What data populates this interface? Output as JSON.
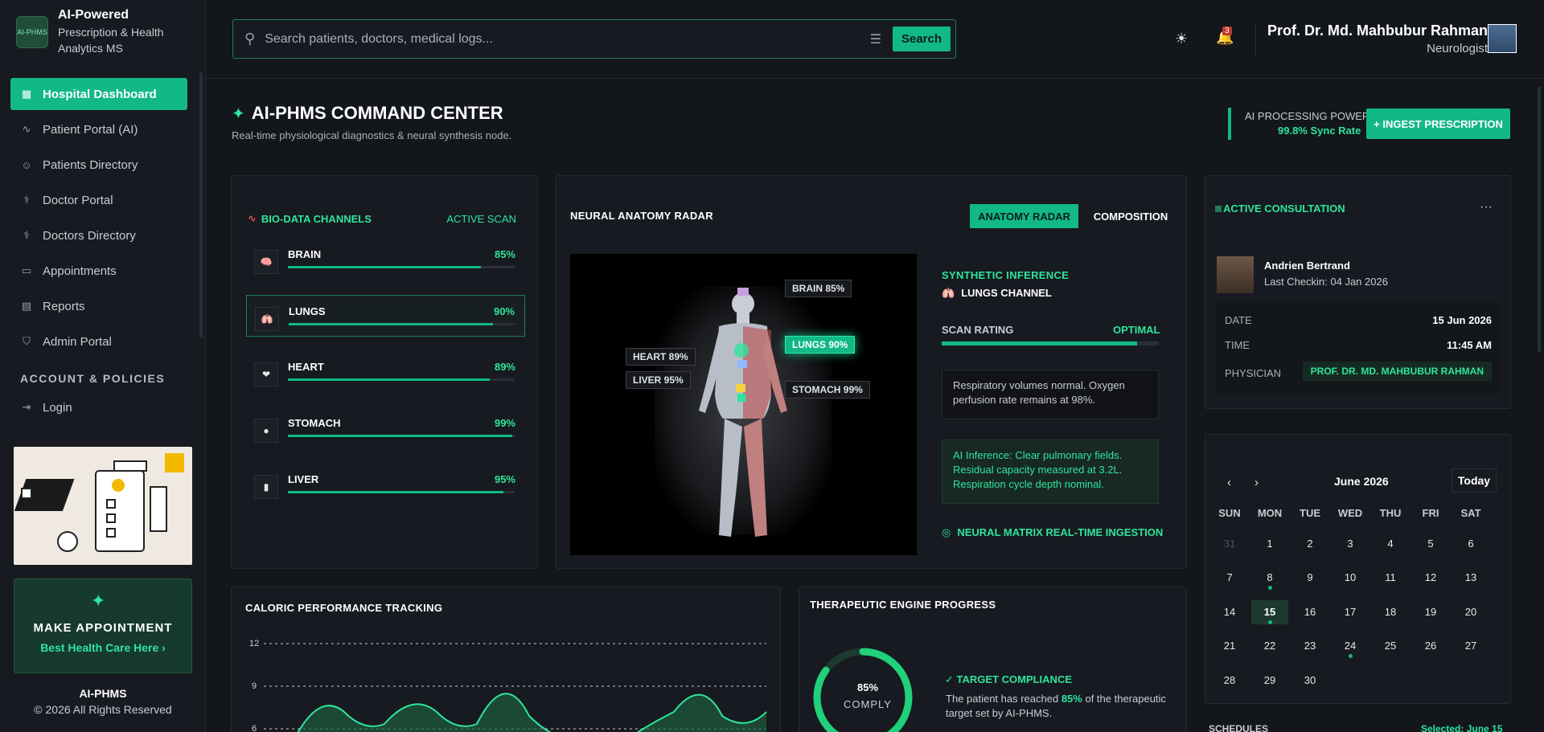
{
  "brand": {
    "logo_text": "AI-PHMS",
    "title": "AI-Powered",
    "subtitle_lines": [
      "Prescription & Health",
      "Analytics MS"
    ]
  },
  "nav": [
    {
      "label": "Hospital Dashboard",
      "icon": "grid-icon",
      "active": true
    },
    {
      "label": "Patient Portal (AI)",
      "icon": "activity-icon"
    },
    {
      "label": "Patients Directory",
      "icon": "users-icon"
    },
    {
      "label": "Doctor Portal",
      "icon": "stethoscope-icon"
    },
    {
      "label": "Doctors Directory",
      "icon": "stethoscope-icon"
    },
    {
      "label": "Appointments",
      "icon": "calendar-icon"
    },
    {
      "label": "Reports",
      "icon": "file-icon"
    },
    {
      "label": "Admin Portal",
      "icon": "shield-icon"
    }
  ],
  "account_section": "ACCOUNT & POLICIES",
  "login_label": "Login",
  "appointment_card": {
    "title": "MAKE APPOINTMENT",
    "link": "Best Health Care Here"
  },
  "footer": {
    "name": "AI-PHMS",
    "copyright": "© 2026 All Rights Reserved"
  },
  "search": {
    "placeholder": "Search patients, doctors, medical logs...",
    "button": "Search"
  },
  "notifications_count": "3",
  "user": {
    "name": "Prof. Dr. Md. Mahbubur Rahman",
    "role": "Neurologist"
  },
  "header": {
    "title": "AI-PHMS COMMAND CENTER",
    "subtitle": "Real-time physiological diagnostics & neural synthesis node.",
    "processing_label": "AI PROCESSING POWER",
    "processing_value": "99.8% Sync Rate",
    "ingest_button": "+ INGEST PRESCRIPTION"
  },
  "bio": {
    "title": "BIO-DATA CHANNELS",
    "status": "ACTIVE SCAN",
    "organs": [
      {
        "name": "BRAIN",
        "value": "85%",
        "pct": 85,
        "emoji": "🧠"
      },
      {
        "name": "LUNGS",
        "value": "90%",
        "pct": 90,
        "emoji": "🫁",
        "selected": true
      },
      {
        "name": "HEART",
        "value": "89%",
        "pct": 89,
        "emoji": "❤"
      },
      {
        "name": "STOMACH",
        "value": "99%",
        "pct": 99,
        "emoji": "●"
      },
      {
        "name": "LIVER",
        "value": "95%",
        "pct": 95,
        "emoji": "▮"
      }
    ]
  },
  "radar": {
    "title": "NEURAL ANATOMY RADAR",
    "tab_active": "ANATOMY RADAR",
    "tab_other": "COMPOSITION",
    "tags": {
      "brain": "BRAIN 85%",
      "lungs": "LUNGS 90%",
      "heart": "HEART 89%",
      "liver": "LIVER 95%",
      "stomach": "STOMACH 99%"
    },
    "inference_title": "SYNTHETIC INFERENCE",
    "inference_channel": "LUNGS CHANNEL",
    "scan_label": "SCAN RATING",
    "scan_value": "OPTIMAL",
    "scan_pct": 90,
    "note": "Respiratory volumes normal. Oxygen perfusion rate remains at 98%.",
    "ai_note": "AI Inference: Clear pulmonary fields. Residual capacity measured at 3.2L. Respiration cycle depth nominal.",
    "ingestion": "NEURAL MATRIX REAL-TIME INGESTION"
  },
  "consult": {
    "title": "ACTIVE CONSULTATION",
    "patient": "Andrien Bertrand",
    "checkin": "Last Checkin: 04 Jan 2026",
    "date_label": "DATE",
    "date": "15 Jun 2026",
    "time_label": "TIME",
    "time": "11:45 AM",
    "physician_label": "PHYSICIAN",
    "physician": "PROF. DR. MD. MAHBUBUR RAHMAN"
  },
  "calendar": {
    "month": "June 2026",
    "today": "Today",
    "dow": [
      "SUN",
      "MON",
      "TUE",
      "WED",
      "THU",
      "FRI",
      "SAT"
    ],
    "selected_day": 15,
    "dot_days": [
      8,
      15,
      24
    ],
    "schedules": "SCHEDULES",
    "selected_label": "Selected: June 15"
  },
  "caloric": {
    "title": "CALORIC PERFORMANCE TRACKING",
    "y_ticks": [
      "12",
      "9",
      "6"
    ]
  },
  "therapeutic": {
    "title": "THERAPEUTIC ENGINE PROGRESS",
    "percent": "85%",
    "percent_value": 85,
    "label": "COMPLY",
    "target_title": "TARGET COMPLIANCE",
    "desc_pre": "The patient has reached ",
    "desc_pct": "85%",
    "desc_post": " of the therapeutic target set by AI-PHMS."
  },
  "colors": {
    "accent": "#12b886",
    "accent_light": "#2ee59d",
    "background": "#13161b",
    "panel": "#171a20"
  }
}
